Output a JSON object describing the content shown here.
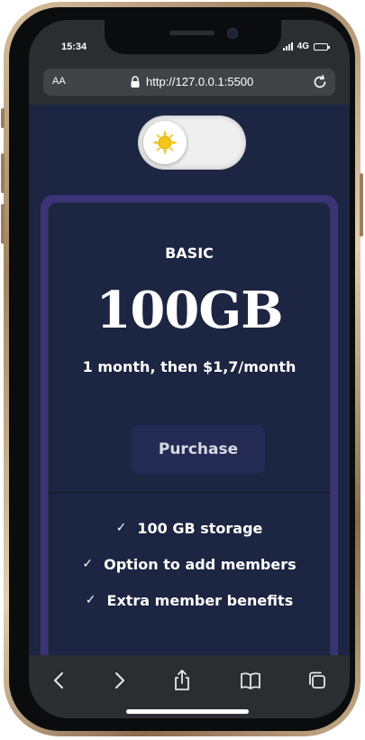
{
  "status_bar": {
    "time": "15:34",
    "network": "4G",
    "icons": [
      "signal-icon",
      "battery-icon"
    ]
  },
  "browser": {
    "text_size_label": "AA",
    "url": "http://127.0.0.1:5500",
    "icons": [
      "lock-icon",
      "reload-icon"
    ]
  },
  "theme_toggle": {
    "mode": "light",
    "icon": "sun-icon"
  },
  "plan": {
    "name": "BASIC",
    "size": "100GB",
    "price": "1 month, then $1,7/month",
    "button_label": "Purchase",
    "features": [
      {
        "label": "100 GB storage"
      },
      {
        "label": "Option to add members"
      },
      {
        "label": "Extra member benefits"
      }
    ],
    "check_symbol": "✓"
  },
  "toolbar": {
    "icons": [
      "back-icon",
      "forward-icon",
      "share-icon",
      "bookmarks-icon",
      "tabs-icon"
    ]
  },
  "colors": {
    "background": "#1c2541",
    "card_border": "#3a3377",
    "button": "#232a53",
    "browser_chrome": "#2b2e31",
    "sun": "#f5c518"
  }
}
